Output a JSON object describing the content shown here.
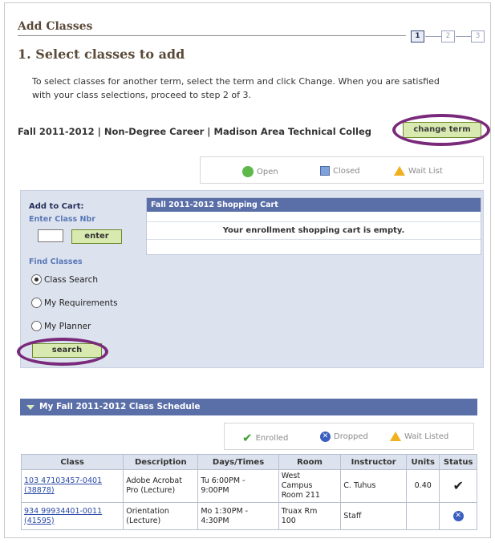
{
  "header": {
    "title": "Add Classes",
    "steps": [
      "1",
      "2",
      "3"
    ],
    "page_title": "1.  Select classes to add",
    "instructions": "To select classes for another term, select the term and click Change.  When you are satisfied with your class selections, proceed to step 2 of 3."
  },
  "term": {
    "text": "Fall 2011-2012 | Non-Degree Career | Madison Area Technical Colleg",
    "change_label": "change term"
  },
  "legend": {
    "open": "Open",
    "closed": "Closed",
    "wait_list": "Wait List"
  },
  "add_to_cart": {
    "title": "Add to Cart:",
    "enter_nbr_label": "Enter Class Nbr",
    "enter_label": "enter",
    "find_label": "Find Classes",
    "options": [
      "Class Search",
      "My Requirements",
      "My Planner"
    ],
    "selected": "Class Search",
    "search_label": "search"
  },
  "cart": {
    "title": "Fall 2011-2012 Shopping Cart",
    "empty_message": "Your enrollment shopping cart is empty."
  },
  "schedule": {
    "title": "My Fall 2011-2012 Class Schedule",
    "legend": {
      "enrolled": "Enrolled",
      "dropped": "Dropped",
      "wait_listed": "Wait Listed"
    },
    "columns": [
      "Class",
      "Description",
      "Days/Times",
      "Room",
      "Instructor",
      "Units",
      "Status"
    ],
    "rows": [
      {
        "class_line1": "103 47103457-0401",
        "class_line2": "(38878)",
        "desc_line1": "Adobe Acrobat",
        "desc_line2": "Pro (Lecture)",
        "days_line1": "Tu 6:00PM -",
        "days_line2": "9:00PM",
        "room_line1": "West",
        "room_line2": "Campus",
        "room_line3": "Room 211",
        "instructor": "C. Tuhus",
        "units": "0.40",
        "status": "enrolled"
      },
      {
        "class_line1": "934 99934401-0011",
        "class_line2": "(41595)",
        "desc_line1": "Orientation",
        "desc_line2": "(Lecture)",
        "days_line1": "Mo 1:30PM -",
        "days_line2": "4:30PM",
        "room_line1": "Truax Rm",
        "room_line2": "100",
        "room_line3": "",
        "instructor": "Staff",
        "units": "",
        "status": "dropped"
      }
    ]
  },
  "colors": {
    "accent": "#5a6ea8",
    "button": "#d9eab0",
    "highlight_ring": "#7a2a7a"
  }
}
